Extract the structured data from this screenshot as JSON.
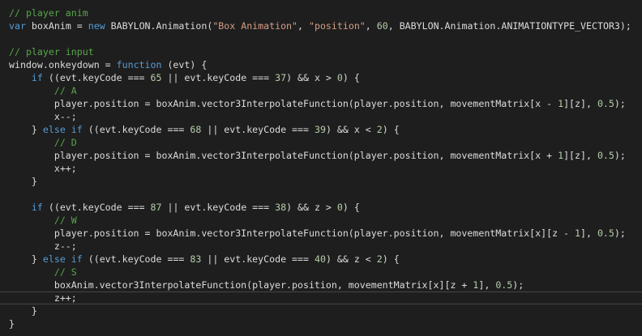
{
  "code_lines": [
    [
      {
        "t": "// player anim",
        "c": "comment"
      }
    ],
    [
      {
        "t": "var",
        "c": "keyword"
      },
      {
        "t": " boxAnim = ",
        "c": "plain"
      },
      {
        "t": "new",
        "c": "keyword"
      },
      {
        "t": " BABYLON.Animation(",
        "c": "plain"
      },
      {
        "t": "\"Box Animation\"",
        "c": "string"
      },
      {
        "t": ", ",
        "c": "plain"
      },
      {
        "t": "\"position\"",
        "c": "string"
      },
      {
        "t": ", ",
        "c": "plain"
      },
      {
        "t": "60",
        "c": "number"
      },
      {
        "t": ", BABYLON.Animation.ANIMATIONTYPE_VECTOR3);",
        "c": "plain"
      }
    ],
    [],
    [
      {
        "t": "// player input",
        "c": "comment"
      }
    ],
    [
      {
        "t": "window.onkeydown = ",
        "c": "plain"
      },
      {
        "t": "function",
        "c": "keyword"
      },
      {
        "t": " (evt) {",
        "c": "plain"
      }
    ],
    [
      {
        "t": "    ",
        "c": "plain"
      },
      {
        "t": "if",
        "c": "keyword"
      },
      {
        "t": " ((evt.keyCode === ",
        "c": "plain"
      },
      {
        "t": "65",
        "c": "number"
      },
      {
        "t": " || evt.keyCode === ",
        "c": "plain"
      },
      {
        "t": "37",
        "c": "number"
      },
      {
        "t": ") && x > ",
        "c": "plain"
      },
      {
        "t": "0",
        "c": "number"
      },
      {
        "t": ") {",
        "c": "plain"
      }
    ],
    [
      {
        "t": "        ",
        "c": "plain"
      },
      {
        "t": "// A",
        "c": "comment"
      }
    ],
    [
      {
        "t": "        player.position = boxAnim.vector3InterpolateFunction(player.position, movementMatrix[x - ",
        "c": "plain"
      },
      {
        "t": "1",
        "c": "number"
      },
      {
        "t": "][z], ",
        "c": "plain"
      },
      {
        "t": "0.5",
        "c": "number"
      },
      {
        "t": ");",
        "c": "plain"
      }
    ],
    [
      {
        "t": "        x--;",
        "c": "plain"
      }
    ],
    [
      {
        "t": "    } ",
        "c": "plain"
      },
      {
        "t": "else",
        "c": "keyword"
      },
      {
        "t": " ",
        "c": "plain"
      },
      {
        "t": "if",
        "c": "keyword"
      },
      {
        "t": " ((evt.keyCode === ",
        "c": "plain"
      },
      {
        "t": "68",
        "c": "number"
      },
      {
        "t": " || evt.keyCode === ",
        "c": "plain"
      },
      {
        "t": "39",
        "c": "number"
      },
      {
        "t": ") && x < ",
        "c": "plain"
      },
      {
        "t": "2",
        "c": "number"
      },
      {
        "t": ") {",
        "c": "plain"
      }
    ],
    [
      {
        "t": "        ",
        "c": "plain"
      },
      {
        "t": "// D",
        "c": "comment"
      }
    ],
    [
      {
        "t": "        player.position = boxAnim.vector3InterpolateFunction(player.position, movementMatrix[x + ",
        "c": "plain"
      },
      {
        "t": "1",
        "c": "number"
      },
      {
        "t": "][z], ",
        "c": "plain"
      },
      {
        "t": "0.5",
        "c": "number"
      },
      {
        "t": ");",
        "c": "plain"
      }
    ],
    [
      {
        "t": "        x++;",
        "c": "plain"
      }
    ],
    [
      {
        "t": "    }",
        "c": "plain"
      }
    ],
    [],
    [
      {
        "t": "    ",
        "c": "plain"
      },
      {
        "t": "if",
        "c": "keyword"
      },
      {
        "t": " ((evt.keyCode === ",
        "c": "plain"
      },
      {
        "t": "87",
        "c": "number"
      },
      {
        "t": " || evt.keyCode === ",
        "c": "plain"
      },
      {
        "t": "38",
        "c": "number"
      },
      {
        "t": ") && z > ",
        "c": "plain"
      },
      {
        "t": "0",
        "c": "number"
      },
      {
        "t": ") {",
        "c": "plain"
      }
    ],
    [
      {
        "t": "        ",
        "c": "plain"
      },
      {
        "t": "// W",
        "c": "comment"
      }
    ],
    [
      {
        "t": "        player.position = boxAnim.vector3InterpolateFunction(player.position, movementMatrix[x][z - ",
        "c": "plain"
      },
      {
        "t": "1",
        "c": "number"
      },
      {
        "t": "], ",
        "c": "plain"
      },
      {
        "t": "0.5",
        "c": "number"
      },
      {
        "t": ");",
        "c": "plain"
      }
    ],
    [
      {
        "t": "        z--;",
        "c": "plain"
      }
    ],
    [
      {
        "t": "    } ",
        "c": "plain"
      },
      {
        "t": "else",
        "c": "keyword"
      },
      {
        "t": " ",
        "c": "plain"
      },
      {
        "t": "if",
        "c": "keyword"
      },
      {
        "t": " ((evt.keyCode === ",
        "c": "plain"
      },
      {
        "t": "83",
        "c": "number"
      },
      {
        "t": " || evt.keyCode === ",
        "c": "plain"
      },
      {
        "t": "40",
        "c": "number"
      },
      {
        "t": ") && z < ",
        "c": "plain"
      },
      {
        "t": "2",
        "c": "number"
      },
      {
        "t": ") {",
        "c": "plain"
      }
    ],
    [
      {
        "t": "        ",
        "c": "plain"
      },
      {
        "t": "// S",
        "c": "comment"
      }
    ],
    [
      {
        "t": "        boxAnim.vector3InterpolateFunction(player.position, movementMatrix[x][z + ",
        "c": "plain"
      },
      {
        "t": "1",
        "c": "number"
      },
      {
        "t": "], ",
        "c": "plain"
      },
      {
        "t": "0.5",
        "c": "number"
      },
      {
        "t": ");",
        "c": "plain"
      }
    ],
    [
      {
        "t": "        z++;",
        "c": "plain"
      }
    ],
    [
      {
        "t": "    }",
        "c": "plain"
      }
    ],
    [
      {
        "t": "}",
        "c": "plain"
      }
    ]
  ],
  "current_line_index": 22,
  "colors": {
    "background": "#1e1e1e",
    "comment": "#57a64a",
    "keyword": "#569cd6",
    "string": "#d69d85",
    "number": "#b5cea8",
    "plain": "#dcdcdc",
    "current_line_border": "#464646"
  }
}
